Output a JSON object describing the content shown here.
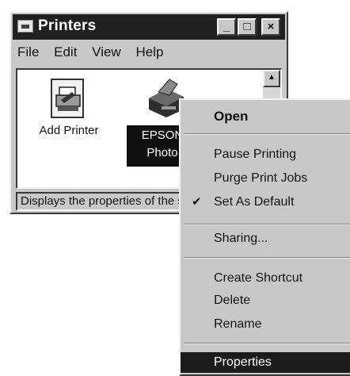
{
  "window": {
    "title": "Printers",
    "controls": {
      "minimize": "_",
      "maximize": "□",
      "close": "×"
    }
  },
  "menubar": {
    "items": [
      "File",
      "Edit",
      "View",
      "Help"
    ]
  },
  "printers": [
    {
      "label": "Add Printer",
      "icon": "add-printer-icon"
    },
    {
      "label_line1": "EPSON",
      "label_line2": "Photo",
      "icon": "printer-icon",
      "selected": true
    }
  ],
  "statusbar": {
    "text": "Displays the properties of the selected printer."
  },
  "context_menu": {
    "items": [
      {
        "label": "Open",
        "bold": true
      },
      {
        "separator": true
      },
      {
        "label": "Pause Printing"
      },
      {
        "label": "Purge Print Jobs"
      },
      {
        "label": "Set As Default",
        "checked": true
      },
      {
        "separator": true
      },
      {
        "label": "Sharing..."
      },
      {
        "separator": true
      },
      {
        "label": "Create Shortcut"
      },
      {
        "label": "Delete"
      },
      {
        "label": "Rename"
      },
      {
        "separator": true
      },
      {
        "label": "Properties",
        "highlighted": true
      }
    ]
  },
  "icons": {
    "check": "✔",
    "scroll_up": "▲"
  },
  "colors": {
    "titlebar": "#202020",
    "face": "#c8c8c8",
    "highlight": "#1c1c1c"
  }
}
